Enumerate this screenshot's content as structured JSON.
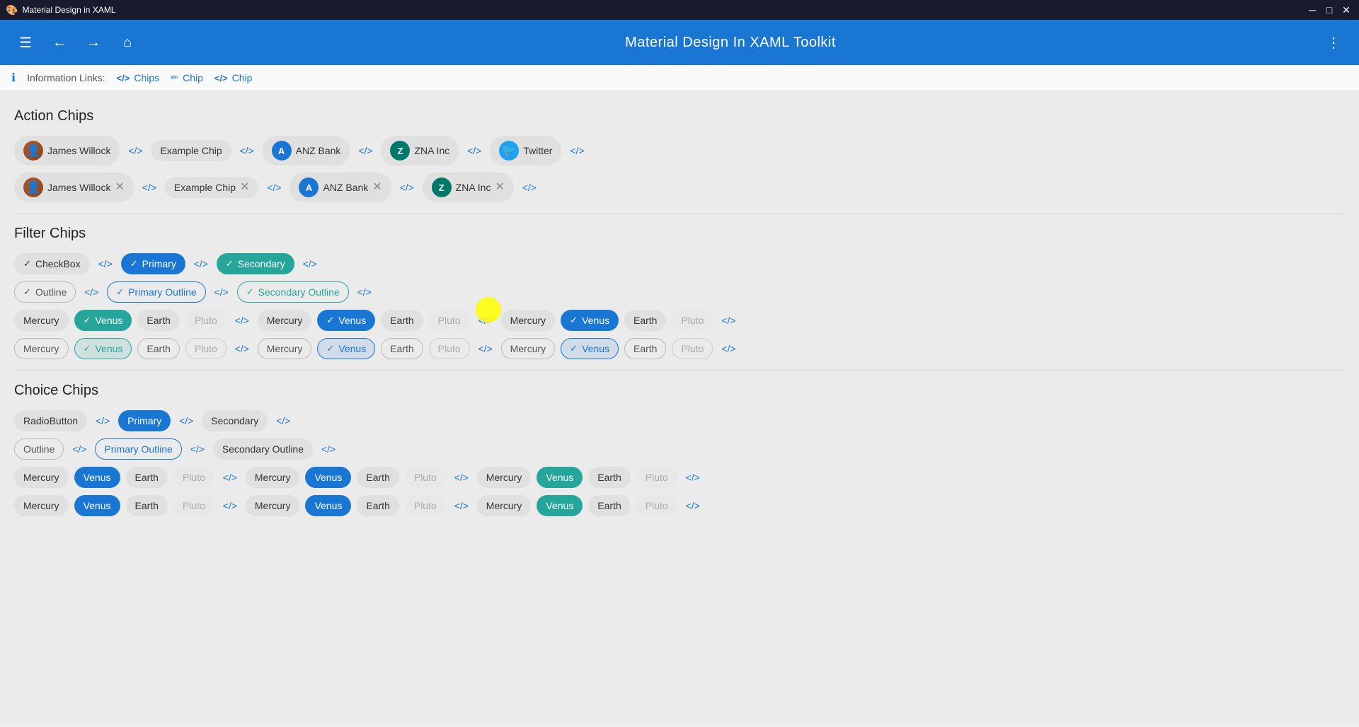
{
  "titlebar": {
    "app_name": "Material Design in XAML",
    "min": "─",
    "max": "□",
    "close": "✕"
  },
  "toolbar": {
    "title": "Material Design In XAML Toolkit",
    "menu_icon": "☰",
    "back_icon": "←",
    "forward_icon": "→",
    "home_icon": "⌂",
    "more_icon": "⋮"
  },
  "infobar": {
    "info_icon": "ℹ",
    "label": "Information Links:",
    "links": [
      {
        "icon": "</>",
        "label": "Chips"
      },
      {
        "icon": "✏",
        "label": "Chip"
      },
      {
        "icon": "</>",
        "label": "Chip"
      }
    ]
  },
  "action_chips": {
    "title": "Action Chips",
    "row1": [
      {
        "type": "person",
        "label": "James Willock"
      },
      {
        "type": "text",
        "label": "Example Chip"
      },
      {
        "type": "initial",
        "initial": "A",
        "color": "blue",
        "label": "ANZ Bank"
      },
      {
        "type": "initial",
        "initial": "Z",
        "color": "teal",
        "label": "ZNA Inc"
      },
      {
        "type": "twitter",
        "label": "Twitter"
      }
    ],
    "row2": [
      {
        "type": "person",
        "label": "James Willock",
        "closeable": true
      },
      {
        "type": "text",
        "label": "Example Chip",
        "closeable": true
      },
      {
        "type": "initial",
        "initial": "A",
        "color": "blue",
        "label": "ANZ Bank",
        "closeable": true
      },
      {
        "type": "initial",
        "initial": "Z",
        "color": "teal",
        "label": "ZNA Inc",
        "closeable": true
      }
    ]
  },
  "filter_chips": {
    "title": "Filter Chips",
    "style_row": [
      {
        "label": "CheckBox",
        "selected": true,
        "style": ""
      },
      {
        "label": "Primary",
        "selected": true,
        "style": "primary"
      },
      {
        "label": "Secondary",
        "selected": true,
        "style": "secondary"
      }
    ],
    "style_row2": [
      {
        "label": "Outline",
        "selected": true,
        "style": "outlined"
      },
      {
        "label": "Primary Outline",
        "selected": true,
        "style": "primary-outline"
      },
      {
        "label": "Secondary Outline",
        "selected": true,
        "style": "secondary-outline"
      }
    ],
    "planet_groups": [
      {
        "chips": [
          {
            "label": "Mercury",
            "selected": false
          },
          {
            "label": "Venus",
            "selected": true,
            "style": "venus-selected"
          },
          {
            "label": "Earth",
            "selected": false
          },
          {
            "label": "Pluto",
            "selected": false,
            "dim": true
          }
        ]
      },
      {
        "chips": [
          {
            "label": "Mercury",
            "selected": false
          },
          {
            "label": "Venus",
            "selected": true,
            "style": "venus-selected-primary"
          },
          {
            "label": "Earth",
            "selected": false
          },
          {
            "label": "Pluto",
            "selected": false,
            "dim": true
          }
        ]
      },
      {
        "chips": [
          {
            "label": "Mercury",
            "selected": false
          },
          {
            "label": "Venus",
            "selected": true,
            "style": "venus-selected-primary"
          },
          {
            "label": "Earth",
            "selected": false
          },
          {
            "label": "Pluto",
            "selected": false,
            "dim": true
          }
        ]
      }
    ],
    "planet_groups2": [
      {
        "chips": [
          {
            "label": "Mercury",
            "selected": false
          },
          {
            "label": "Venus",
            "selected": true,
            "style": "venus-selected-outline"
          },
          {
            "label": "Earth",
            "selected": false
          },
          {
            "label": "Pluto",
            "selected": false,
            "dim": true
          }
        ]
      },
      {
        "chips": [
          {
            "label": "Mercury",
            "selected": false
          },
          {
            "label": "Venus",
            "selected": true,
            "style": "venus-selected-primary-outline"
          },
          {
            "label": "Earth",
            "selected": false
          },
          {
            "label": "Pluto",
            "selected": false,
            "dim": true
          }
        ]
      },
      {
        "chips": [
          {
            "label": "Mercury",
            "selected": false
          },
          {
            "label": "Venus",
            "selected": true,
            "style": "venus-selected-primary-outline"
          },
          {
            "label": "Earth",
            "selected": false
          },
          {
            "label": "Pluto",
            "selected": false,
            "dim": true
          }
        ]
      }
    ]
  },
  "choice_chips": {
    "title": "Choice Chips",
    "style_row1": [
      {
        "label": "RadioButton",
        "style": ""
      },
      {
        "label": "Primary",
        "style": "primary"
      },
      {
        "label": "Secondary",
        "style": ""
      }
    ],
    "style_row2": [
      {
        "label": "Outline",
        "style": "outlined"
      },
      {
        "label": "Primary Outline",
        "style": "primary-outline"
      },
      {
        "label": "Secondary Outline",
        "style": ""
      }
    ],
    "planet_groups": [
      {
        "chips": [
          {
            "label": "Mercury",
            "selected": false
          },
          {
            "label": "Venus",
            "selected": true,
            "style": "selected-primary"
          },
          {
            "label": "Earth",
            "selected": false
          },
          {
            "label": "Pluto",
            "selected": false,
            "dim": true
          }
        ]
      },
      {
        "chips": [
          {
            "label": "Mercury",
            "selected": false
          },
          {
            "label": "Venus",
            "selected": true,
            "style": "selected-primary"
          },
          {
            "label": "Earth",
            "selected": false
          },
          {
            "label": "Pluto",
            "selected": false,
            "dim": true
          }
        ]
      },
      {
        "chips": [
          {
            "label": "Mercury",
            "selected": false
          },
          {
            "label": "Venus",
            "selected": true,
            "style": "selected-secondary"
          },
          {
            "label": "Earth",
            "selected": false
          },
          {
            "label": "Pluto",
            "selected": false,
            "dim": true
          }
        ]
      }
    ],
    "planet_groups2": [
      {
        "chips": [
          {
            "label": "Mercury",
            "selected": false
          },
          {
            "label": "Venus",
            "selected": true,
            "style": "selected-primary"
          },
          {
            "label": "Earth",
            "selected": false
          },
          {
            "label": "Pluto",
            "selected": false,
            "dim": true
          }
        ]
      },
      {
        "chips": [
          {
            "label": "Mercury",
            "selected": false
          },
          {
            "label": "Venus",
            "selected": true,
            "style": "selected-primary"
          },
          {
            "label": "Earth",
            "selected": false
          },
          {
            "label": "Pluto",
            "selected": false,
            "dim": true
          }
        ]
      },
      {
        "chips": [
          {
            "label": "Mercury",
            "selected": false
          },
          {
            "label": "Venus",
            "selected": true,
            "style": "selected-secondary"
          },
          {
            "label": "Earth",
            "selected": false
          },
          {
            "label": "Pluto",
            "selected": false,
            "dim": true
          }
        ]
      }
    ]
  }
}
